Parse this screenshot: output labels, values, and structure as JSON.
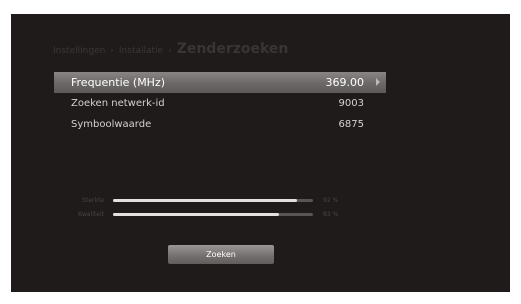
{
  "breadcrumb": {
    "items": [
      "Instellingen",
      "Installatie"
    ],
    "separator": "›",
    "current": "Zenderzoeken"
  },
  "menu": {
    "rows": [
      {
        "label": "Frequentie (MHz)",
        "value": "369.00",
        "selected": true
      },
      {
        "label": "Zoeken netwerk-id",
        "value": "9003"
      },
      {
        "label": "Symboolwaarde",
        "value": "6875"
      }
    ]
  },
  "signal": {
    "strength": {
      "label": "Sterkte",
      "value_text": "92 %",
      "value": 92
    },
    "quality": {
      "label": "Kwaliteit",
      "value_text": "83 %",
      "value": 83
    }
  },
  "search_button": {
    "label": "Zoeken"
  },
  "colors": {
    "screen_background": "#1f1b1b",
    "selected_row": "#6e6a6a",
    "bar_fill": "#e2e0e0",
    "bar_track": "#5a5454"
  }
}
